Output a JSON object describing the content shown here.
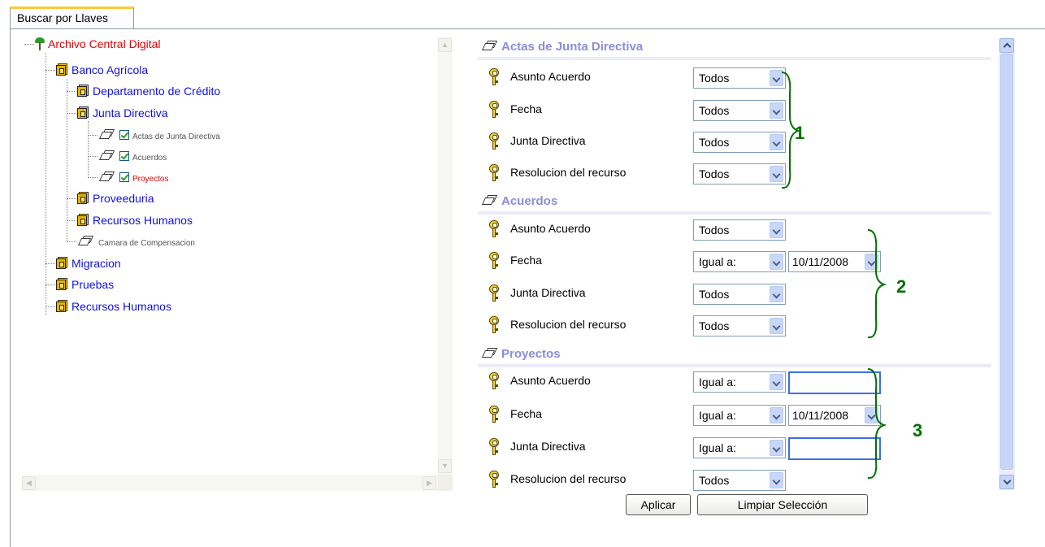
{
  "tab": {
    "label": "Buscar por Llaves"
  },
  "tree": {
    "root": "Archivo Central Digital",
    "banco": "Banco Agrícola",
    "credito": "Departamento de Crédito",
    "junta": "Junta Directiva",
    "actas": "Actas de Junta Directiva",
    "acuerdos": "Acuerdos",
    "proyectos": "Proyectos",
    "proveeduria": "Proveeduria",
    "rrhh1": "Recursos Humanos",
    "camara": "Camara de Compensacion",
    "migracion": "Migracion",
    "pruebas": "Pruebas",
    "rrhh2": "Recursos Humanos"
  },
  "sections": {
    "s1": {
      "title": "Actas de Junta Directiva",
      "number": "1",
      "rows": [
        {
          "label": "Asunto Acuerdo",
          "op": "Todos"
        },
        {
          "label": "Fecha",
          "op": "Todos"
        },
        {
          "label": "Junta Directiva",
          "op": "Todos"
        },
        {
          "label": "Resolucion del recurso",
          "op": "Todos"
        }
      ]
    },
    "s2": {
      "title": "Acuerdos",
      "number": "2",
      "rows": [
        {
          "label": "Asunto Acuerdo",
          "op": "Todos"
        },
        {
          "label": "Fecha",
          "op": "Igual a:",
          "date": "10/11/2008"
        },
        {
          "label": "Junta Directiva",
          "op": "Todos"
        },
        {
          "label": "Resolucion del recurso",
          "op": "Todos"
        }
      ]
    },
    "s3": {
      "title": "Proyectos",
      "number": "3",
      "rows": [
        {
          "label": "Asunto Acuerdo",
          "op": "Igual a:"
        },
        {
          "label": "Fecha",
          "op": "Igual a:",
          "date": "10/11/2008"
        },
        {
          "label": "Junta Directiva",
          "op": "Igual a:"
        },
        {
          "label": "Resolucion del recurso",
          "op": "Todos"
        }
      ]
    }
  },
  "buttons": {
    "apply": "Aplicar",
    "clear": "Limpiar Selección"
  },
  "colors": {
    "tab_accent": "#ffc83c",
    "root_text": "#e00000",
    "link_blue": "#1010e0",
    "section_title": "#8c8cd8",
    "annotation_green": "#007000"
  }
}
